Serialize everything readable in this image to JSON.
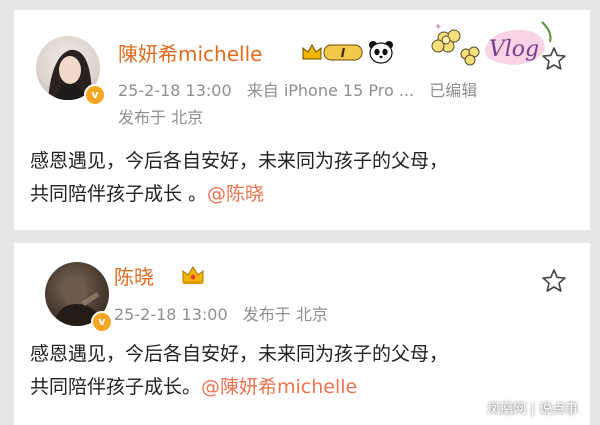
{
  "post1": {
    "username": "陳妍希michelle",
    "timestamp": "25-2-18 13:00",
    "source": "来自 iPhone 15 Pro ...",
    "edited": "已编辑",
    "location": "发布于 北京",
    "content_line1": "感恩遇见，今后各自安好，未来同为孩子的父母，",
    "content_line2": "共同陪伴孩子成长 。",
    "mention": "@陈晓",
    "level_badge": "I",
    "sticker_text": "Vlog",
    "icons": [
      "crown-level-badge-icon",
      "panda-icon",
      "flower-sticker-icon",
      "star-icon",
      "verified-icon"
    ]
  },
  "post2": {
    "username": "陈晓",
    "timestamp": "25-2-18 13:00",
    "location": "发布于 北京",
    "content_line1": "感恩遇见，今后各自安好，未来同为孩子的父母，",
    "content_line2": "共同陪伴孩子成长。",
    "mention": "@陳妍希michelle",
    "icons": [
      "crown-icon",
      "star-icon",
      "verified-icon"
    ]
  },
  "watermark": "凤凰网 | 说点事",
  "colors": {
    "username": "#e06b1e",
    "mention": "#eb7350",
    "meta": "#8f8f8f",
    "verified": "#f5a623",
    "background": "#e6e6e6"
  }
}
